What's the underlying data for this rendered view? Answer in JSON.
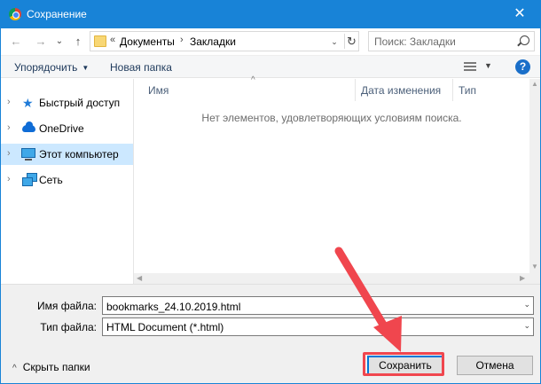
{
  "window": {
    "title": "Сохранение",
    "close_glyph": "✕"
  },
  "nav": {
    "back_glyph": "←",
    "forward_glyph": "→",
    "recent_glyph": "⌄",
    "up_glyph": "↑",
    "address": {
      "overflow": "«",
      "path": [
        "Документы",
        "Закладки"
      ],
      "separator": "›",
      "drop_glyph": "⌄",
      "refresh_glyph": "↻"
    },
    "search_placeholder": "Поиск: Закладки"
  },
  "command_bar": {
    "organize_label": "Упорядочить",
    "organize_caret": "▼",
    "new_folder_label": "Новая папка",
    "view_drop_glyph": "▼",
    "help_glyph": "?"
  },
  "tree": [
    {
      "label": "Быстрый доступ",
      "icon": "star-icon",
      "selected": false
    },
    {
      "label": "OneDrive",
      "icon": "cloud-icon",
      "selected": false
    },
    {
      "label": "Этот компьютер",
      "icon": "pc-icon",
      "selected": true
    },
    {
      "label": "Сеть",
      "icon": "network-icon",
      "selected": false
    }
  ],
  "tree_chevron": "›",
  "file_list": {
    "columns": [
      "Имя",
      "Дата изменения",
      "Тип"
    ],
    "sort_glyph": "^",
    "empty_message": "Нет элементов, удовлетворяющих условиям поиска."
  },
  "form": {
    "filename_label": "Имя файла:",
    "filename_value": "bookmarks_24.10.2019.html",
    "filetype_label": "Тип файла:",
    "filetype_value": "HTML Document (*.html)",
    "drop_glyph": "⌄",
    "collapse_caret": "^",
    "collapse_label": "Скрыть папки",
    "save_label": "Сохранить",
    "cancel_label": "Отмена"
  },
  "colors": {
    "titlebar": "#1883d7",
    "selection": "#cce8ff",
    "annotation": "#f0464e"
  }
}
